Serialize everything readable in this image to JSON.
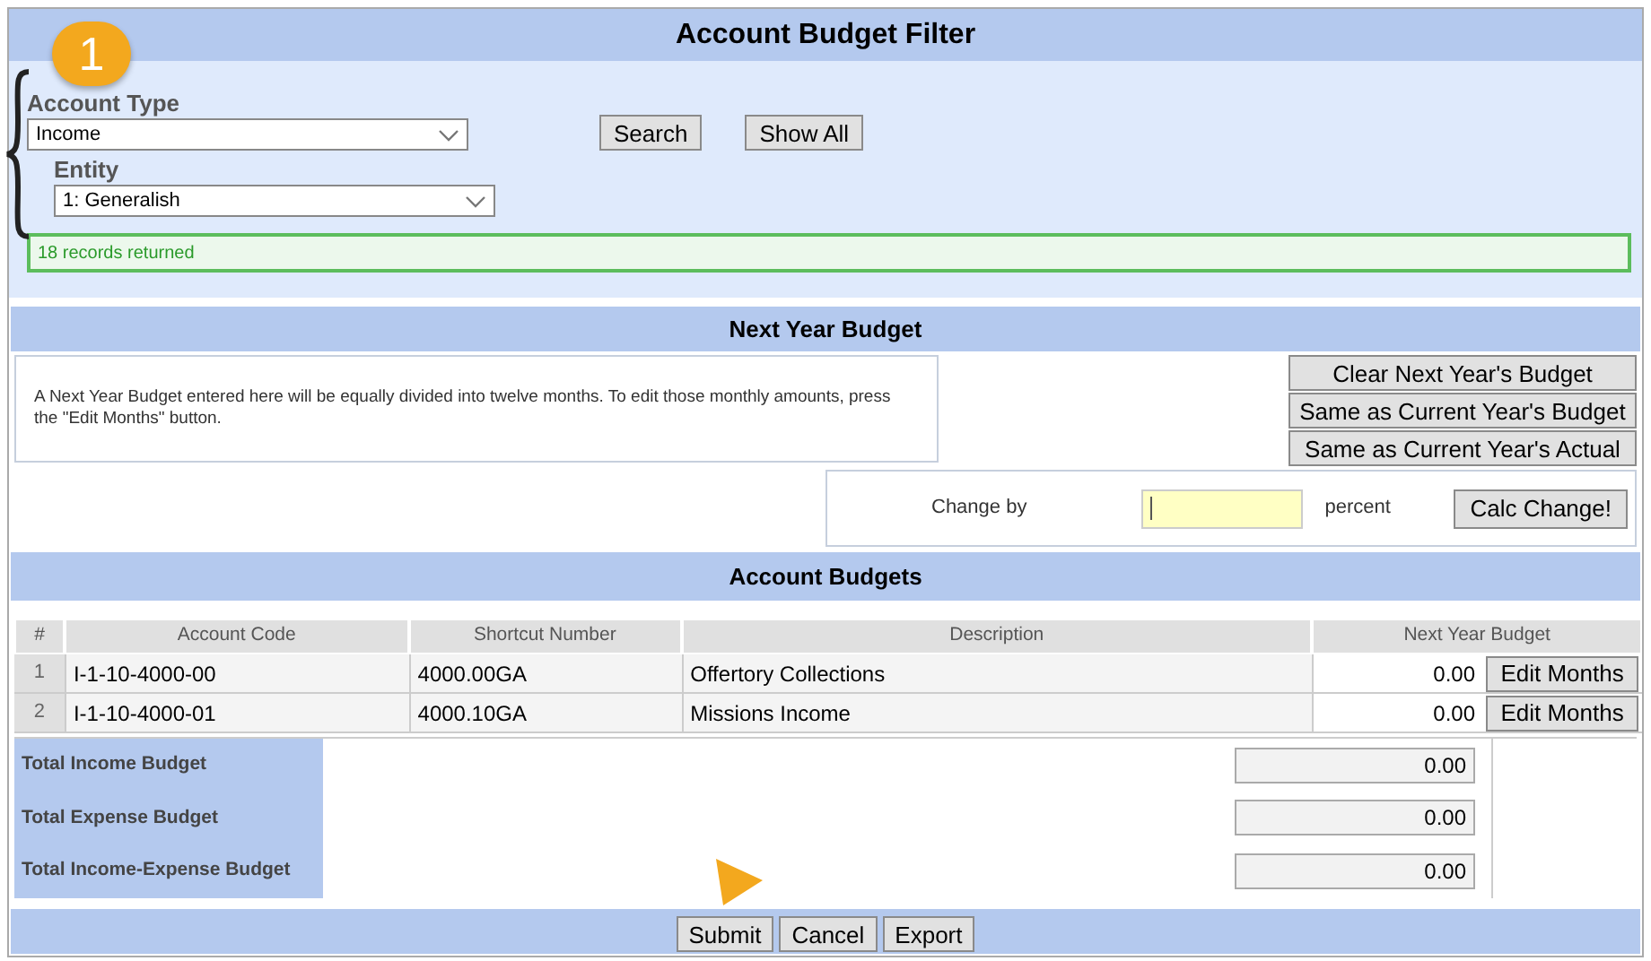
{
  "filter": {
    "title": "Account Budget Filter",
    "callout": "1",
    "account_type": {
      "label": "Account Type",
      "value": "Income"
    },
    "entity": {
      "label": "Entity",
      "value": "1: Generalish"
    },
    "buttons": [
      "Search",
      "Show All"
    ],
    "status": "18 records returned"
  },
  "next_year": {
    "title": "Next Year Budget",
    "note": "A Next Year Budget entered here will be equally divided into twelve months. To edit those monthly amounts, press the \"Edit Months\" button.",
    "buttons": [
      "Clear Next Year's Budget",
      "Same as Current Year's Budget",
      "Same as Current Year's Actual"
    ],
    "change_label": "Change by",
    "unit": "percent",
    "calc_button": "Calc Change!"
  },
  "account_budgets": {
    "title": "Account Budgets",
    "columns": [
      "#",
      "Account Code",
      "Shortcut Number",
      "Description",
      "Next Year Budget"
    ],
    "rows": [
      {
        "num": "1",
        "code": "I-1-10-4000-00",
        "shortcut": "4000.00GA",
        "description": "Offertory Collections",
        "budget": "0.00",
        "button": "Edit Months"
      },
      {
        "num": "2",
        "code": "I-1-10-4000-01",
        "shortcut": "4000.10GA",
        "description": "Missions Income",
        "budget": "0.00",
        "button": "Edit Months"
      }
    ]
  },
  "totals": [
    {
      "label": "Total Income Budget",
      "value": "0.00"
    },
    {
      "label": "Total Expense Budget",
      "value": "0.00"
    },
    {
      "label": "Total Income-Expense Budget",
      "value": "0.00"
    }
  ],
  "footer_buttons": [
    "Submit",
    "Cancel",
    "Export"
  ]
}
